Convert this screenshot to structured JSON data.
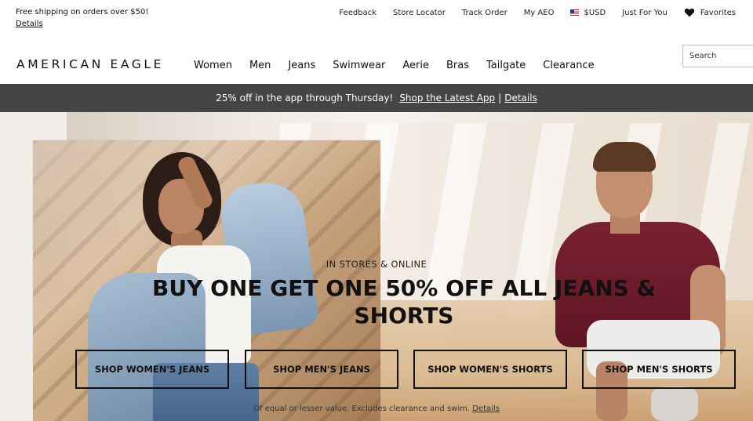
{
  "utility": {
    "shipping_text": "Free shipping on orders over $50!",
    "shipping_details": "Details",
    "links": [
      "Feedback",
      "Store Locator",
      "Track Order",
      "My AEO"
    ],
    "currency": "$USD",
    "just_for_you": "Just For You",
    "favorites": "Favorites"
  },
  "header": {
    "logo": "AMERICAN EAGLE",
    "nav": [
      "Women",
      "Men",
      "Jeans",
      "Swimwear",
      "Aerie",
      "Bras",
      "Tailgate",
      "Clearance"
    ],
    "search_placeholder": "Search"
  },
  "promo_bar": {
    "text": "25% off in the app through Thursday!",
    "link1": "Shop the Latest App",
    "separator": "|",
    "link2": "Details"
  },
  "hero": {
    "kicker": "IN STORES & ONLINE",
    "headline": "BUY ONE GET ONE 50% OFF ALL JEANS & SHORTS",
    "ctas": [
      "SHOP WOMEN'S JEANS",
      "SHOP MEN'S JEANS",
      "SHOP WOMEN'S SHORTS",
      "SHOP MEN'S SHORTS"
    ],
    "fine_print": "Of equal or lesser value. Excludes clearance and swim.",
    "fine_print_link": "Details"
  },
  "colors": {
    "promo_bar_bg": "#454545",
    "text": "#111111"
  }
}
